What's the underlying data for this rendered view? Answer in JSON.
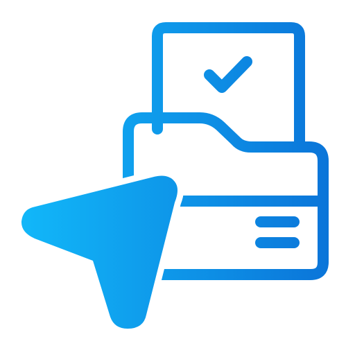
{
  "icon": {
    "name": "folder-document-pointer-icon",
    "depicts": [
      "document-icon",
      "checkmark-icon",
      "folder-icon",
      "pointer-arrow-icon",
      "drawer-handle-icon"
    ],
    "colors": {
      "gradient_start": "#12BCFB",
      "gradient_end": "#0A6FD6",
      "background": "#FFFFFF"
    }
  }
}
